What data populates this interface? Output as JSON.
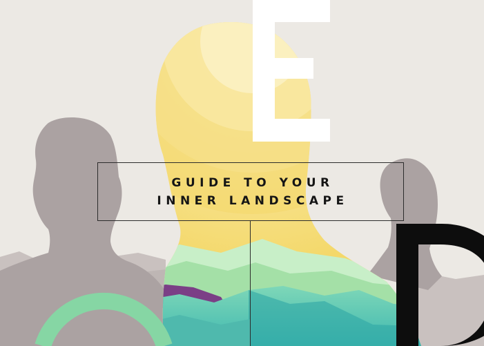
{
  "title": {
    "line1": "GUIDE TO YOUR",
    "line2": "INNER LANDSCAPE"
  },
  "decor_letters": [
    "E",
    "D"
  ],
  "colors": {
    "background": "#ece9e4",
    "silhouette_gray": "#aba2a2",
    "head_yellow": "#f5dd79",
    "landscape_teal": "#5ec4b3",
    "landscape_green": "#a4e0a7",
    "accent_purple": "#7b3f86",
    "arc_green": "#86d6a4",
    "letter_white": "#ffffff",
    "letter_black": "#0d0d0d"
  }
}
